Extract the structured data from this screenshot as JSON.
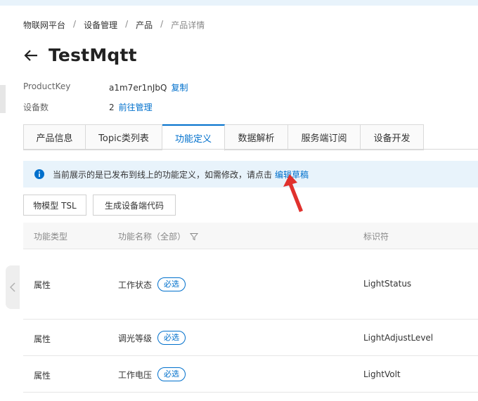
{
  "breadcrumb": [
    "物联网平台",
    "设备管理",
    "产品",
    "产品详情"
  ],
  "breadcrumb_sep": "/",
  "page_title": "TestMqtt",
  "product_key": {
    "label": "ProductKey",
    "value": "a1m7er1nJbQ",
    "action": "复制"
  },
  "device_count": {
    "label": "设备数",
    "value": "2",
    "action": "前往管理"
  },
  "tabs": [
    {
      "label": "产品信息",
      "active": false
    },
    {
      "label": "Topic类列表",
      "active": false
    },
    {
      "label": "功能定义",
      "active": true
    },
    {
      "label": "数据解析",
      "active": false
    },
    {
      "label": "服务端订阅",
      "active": false
    },
    {
      "label": "设备开发",
      "active": false
    }
  ],
  "notice": {
    "text": "当前展示的是已发布到线上的功能定义，如需修改，请点击",
    "link": "编辑草稿"
  },
  "buttons": {
    "tsl": "物模型 TSL",
    "gen_code": "生成设备端代码"
  },
  "table": {
    "headers": {
      "type": "功能类型",
      "name": "功能名称（全部）",
      "identifier": "标识符"
    },
    "rows": [
      {
        "type": "属性",
        "name": "工作状态",
        "tag": "必选",
        "identifier": "LightStatus"
      },
      {
        "type": "属性",
        "name": "调光等级",
        "tag": "必选",
        "identifier": "LightAdjustLevel"
      },
      {
        "type": "属性",
        "name": "工作电压",
        "tag": "必选",
        "identifier": "LightVolt"
      }
    ]
  },
  "colors": {
    "accent": "#0070cc",
    "notice_bg": "#e8f3fb",
    "annotation_arrow": "#e0312d"
  },
  "icons": {
    "back": "arrow-left-icon",
    "info": "info-circle-icon",
    "filter": "filter-icon",
    "collapse": "chevron-left-icon"
  }
}
